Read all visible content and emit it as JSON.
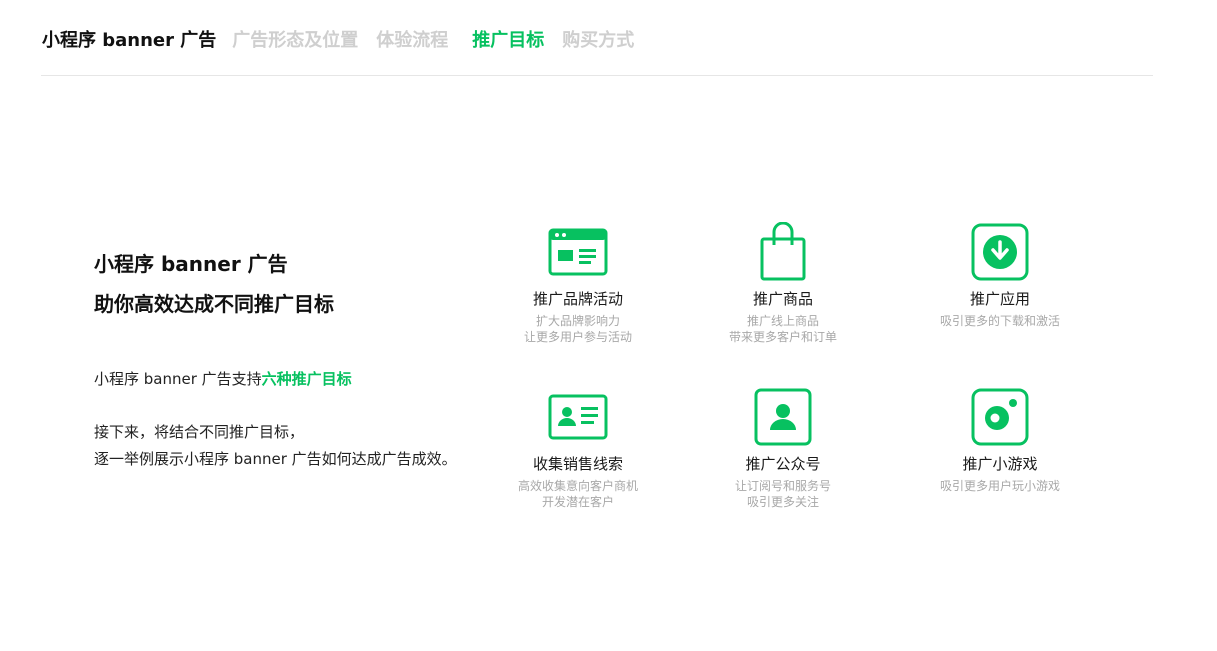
{
  "nav": {
    "title": "小程序 banner 广告",
    "tabs": [
      {
        "label": "广告形态及位置"
      },
      {
        "label": "体验流程"
      },
      {
        "label": "推广目标"
      },
      {
        "label": "购买方式"
      }
    ],
    "active_tab": "推广目标"
  },
  "intro": {
    "headline_line1": "小程序 banner 广告",
    "headline_line2": "助你高效达成不同推广目标",
    "support_prefix": "小程序 banner 广告支持",
    "support_highlight": "六种推广目标",
    "next_line1": "接下来，将结合不同推广目标，",
    "next_line2": "逐一举例展示小程序 banner 广告如何达成广告成效。"
  },
  "goals": [
    {
      "icon": "browser-window-icon",
      "title": "推广品牌活动",
      "sub1": "扩大品牌影响力",
      "sub2": "让更多用户参与活动"
    },
    {
      "icon": "shopping-bag-icon",
      "title": "推广商品",
      "sub1": "推广线上商品",
      "sub2": "带来更多客户和订单"
    },
    {
      "icon": "download-icon",
      "title": "推广应用",
      "sub1": "吸引更多的下载和激活",
      "sub2": ""
    },
    {
      "icon": "id-card-icon",
      "title": "收集销售线索",
      "sub1": "高效收集意向客户商机",
      "sub2": "开发潜在客户"
    },
    {
      "icon": "user-profile-icon",
      "title": "推广公众号",
      "sub1": "让订阅号和服务号",
      "sub2": "吸引更多关注"
    },
    {
      "icon": "mini-game-icon",
      "title": "推广小游戏",
      "sub1": "吸引更多用户玩小游戏",
      "sub2": ""
    }
  ],
  "colors": {
    "accent": "#07c160",
    "inactive_tab": "#cfcfcf",
    "subtext": "#a8a8a8",
    "divider": "#e6e6e6"
  }
}
